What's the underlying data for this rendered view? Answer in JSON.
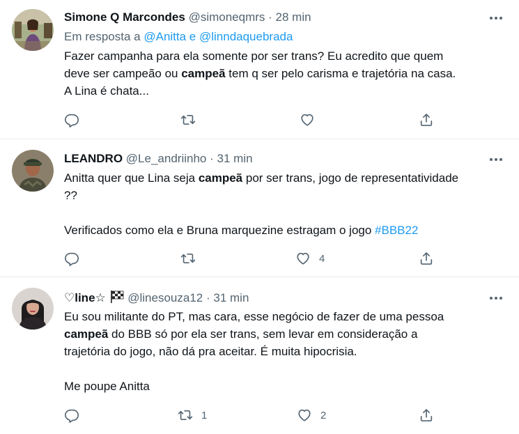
{
  "tweets": [
    {
      "name": "Simone Q Marcondes",
      "handle": "@simoneqmrs",
      "dot": "·",
      "time": "28 min",
      "reply_prefix": "Em resposta a",
      "reply_users": "@Anitta e @linndaquebrada",
      "line1": "Fazer campanha para ela somente por ser trans? Eu acredito que quem",
      "line2_a": "deve ser campeão ou ",
      "line2_bold": "campeã",
      "line2_b": " tem q ser pelo carisma e trajetória na casa.",
      "line3": "A Lina é chata...",
      "counts": {
        "reply": "",
        "retweet": "",
        "like": ""
      }
    },
    {
      "name": "LEANDRO",
      "handle": "@Le_andriinho",
      "dot": "·",
      "time": "31 min",
      "line1_a": "Anitta quer que Lina seja ",
      "line1_bold": "campeã",
      "line1_b": " por ser trans, jogo de representatividade",
      "line2": "??",
      "line3": "Verificados como ela e Bruna marquezine estragam o jogo ",
      "hashtag": "#BBB22",
      "counts": {
        "reply": "",
        "retweet": "",
        "like": "4"
      }
    },
    {
      "name": "♡line☆",
      "handle": "@linesouza12",
      "dot": "·",
      "time": "31 min",
      "line1": "Eu sou militante do PT, mas cara, esse negócio de fazer de uma pessoa",
      "line2_bold": "campeã",
      "line2_b": " do BBB só por ela ser trans, sem levar em consideração a",
      "line3": "trajetória do jogo, não dá pra aceitar. É muita hipocrisia.",
      "line4": "Me poupe Anitta",
      "counts": {
        "reply": "",
        "retweet": "1",
        "like": "2"
      }
    }
  ],
  "icons": {
    "reply": "reply-icon",
    "retweet": "retweet-icon",
    "like": "heart-icon",
    "share": "share-icon",
    "more": "more-options-icon",
    "flag": "checkered-flag-icon"
  },
  "colors": {
    "link": "#1d9bf0",
    "secondary": "#536471",
    "text": "#0f1419"
  }
}
